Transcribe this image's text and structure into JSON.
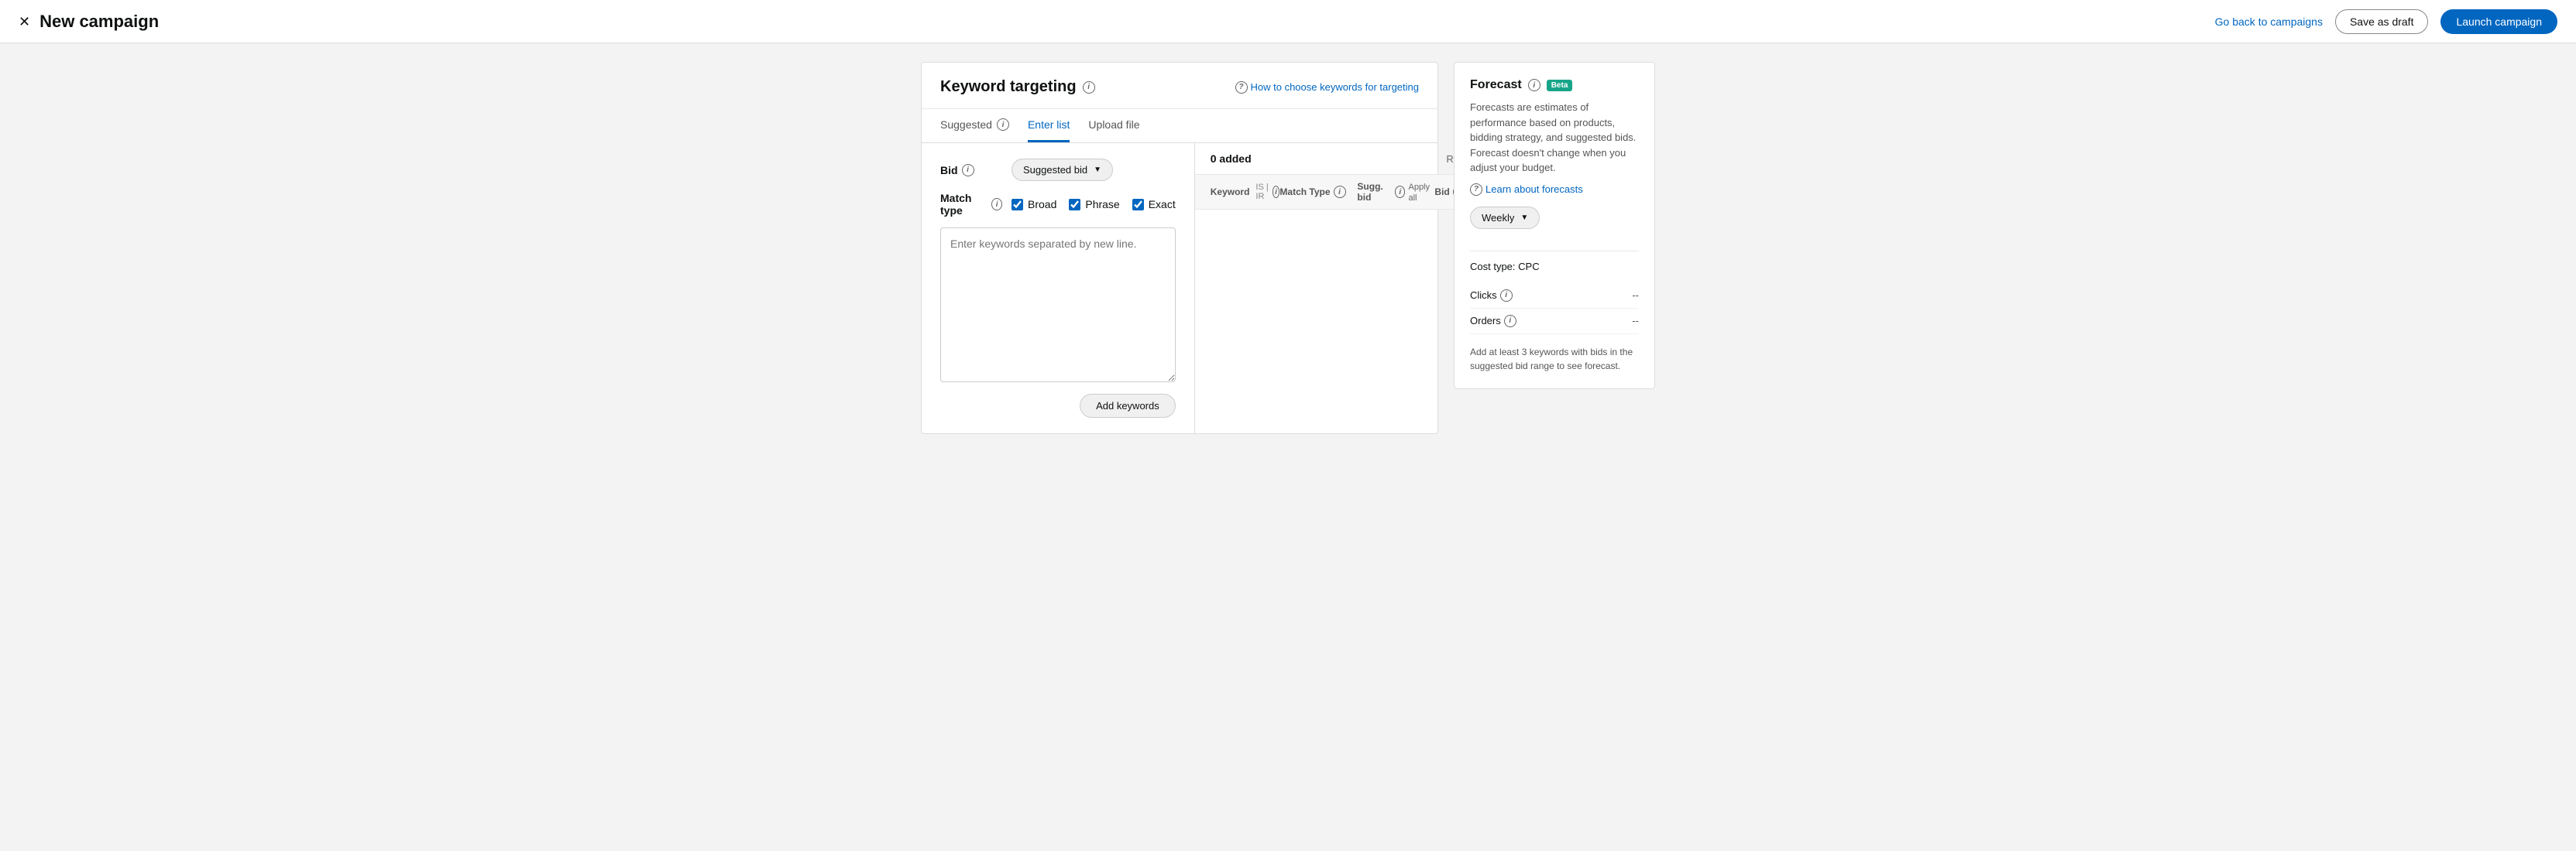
{
  "header": {
    "title": "New campaign",
    "go_back_label": "Go back to campaigns",
    "save_draft_label": "Save as draft",
    "launch_label": "Launch campaign"
  },
  "card": {
    "title": "Keyword targeting",
    "help_link": "How to choose keywords for targeting",
    "tabs": [
      {
        "id": "suggested",
        "label": "Suggested"
      },
      {
        "id": "enter_list",
        "label": "Enter list",
        "active": true
      },
      {
        "id": "upload_file",
        "label": "Upload file"
      }
    ],
    "bid_label": "Bid",
    "bid_option": "Suggested bid",
    "match_type_label": "Match type",
    "match_types": [
      {
        "id": "broad",
        "label": "Broad",
        "checked": true
      },
      {
        "id": "phrase",
        "label": "Phrase",
        "checked": true
      },
      {
        "id": "exact",
        "label": "Exact",
        "checked": true
      }
    ],
    "textarea_placeholder": "Enter keywords separated by new line.",
    "add_keywords_label": "Add keywords",
    "added_count": "0 added",
    "remove_all_label": "Remove all",
    "table_headers": {
      "keyword": "Keyword",
      "keyword_sub": "IS | IR",
      "match_type": "Match Type",
      "sugg_bid": "Sugg. bid",
      "apply_all": "Apply all",
      "bid": "Bid"
    }
  },
  "forecast": {
    "title": "Forecast",
    "beta_label": "Beta",
    "description": "Forecasts are estimates of performance based on products, bidding strategy, and suggested bids. Forecast doesn't change when you adjust your budget.",
    "learn_link": "Learn about forecasts",
    "period_label": "Weekly",
    "cost_type_label": "Cost type: CPC",
    "clicks_label": "Clicks",
    "clicks_value": "--",
    "orders_label": "Orders",
    "orders_value": "--",
    "note": "Add at least 3 keywords with bids in the suggested bid range to see forecast."
  }
}
